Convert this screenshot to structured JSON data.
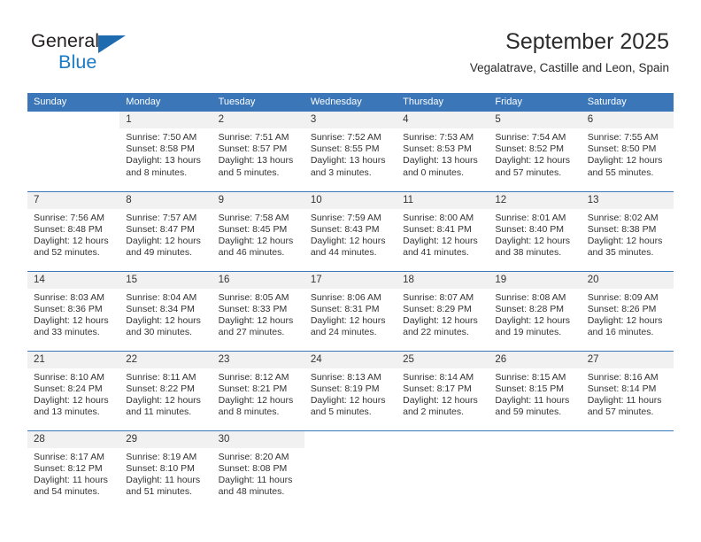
{
  "logo": {
    "word_top": "General",
    "word_bottom": "Blue",
    "triangle_color": "#1f6bb0",
    "blue_text_color": "#1a7ac4"
  },
  "header": {
    "title": "September 2025",
    "subtitle": "Vegalatrave, Castille and Leon, Spain"
  },
  "theme": {
    "header_row_bg": "#3a76b8",
    "header_row_text": "#ffffff",
    "daynum_bg": "#f1f1f1",
    "body_text": "#333333"
  },
  "weekdays": [
    "Sunday",
    "Monday",
    "Tuesday",
    "Wednesday",
    "Thursday",
    "Friday",
    "Saturday"
  ],
  "weeks": [
    [
      {
        "day": "",
        "blank": true,
        "empty": true,
        "sunrise": "",
        "sunset": "",
        "daylight_1": "",
        "daylight_2": ""
      },
      {
        "day": "1",
        "sunrise": "Sunrise: 7:50 AM",
        "sunset": "Sunset: 8:58 PM",
        "daylight_1": "Daylight: 13 hours",
        "daylight_2": "and 8 minutes."
      },
      {
        "day": "2",
        "sunrise": "Sunrise: 7:51 AM",
        "sunset": "Sunset: 8:57 PM",
        "daylight_1": "Daylight: 13 hours",
        "daylight_2": "and 5 minutes."
      },
      {
        "day": "3",
        "sunrise": "Sunrise: 7:52 AM",
        "sunset": "Sunset: 8:55 PM",
        "daylight_1": "Daylight: 13 hours",
        "daylight_2": "and 3 minutes."
      },
      {
        "day": "4",
        "sunrise": "Sunrise: 7:53 AM",
        "sunset": "Sunset: 8:53 PM",
        "daylight_1": "Daylight: 13 hours",
        "daylight_2": "and 0 minutes."
      },
      {
        "day": "5",
        "sunrise": "Sunrise: 7:54 AM",
        "sunset": "Sunset: 8:52 PM",
        "daylight_1": "Daylight: 12 hours",
        "daylight_2": "and 57 minutes."
      },
      {
        "day": "6",
        "sunrise": "Sunrise: 7:55 AM",
        "sunset": "Sunset: 8:50 PM",
        "daylight_1": "Daylight: 12 hours",
        "daylight_2": "and 55 minutes."
      }
    ],
    [
      {
        "day": "7",
        "sunrise": "Sunrise: 7:56 AM",
        "sunset": "Sunset: 8:48 PM",
        "daylight_1": "Daylight: 12 hours",
        "daylight_2": "and 52 minutes."
      },
      {
        "day": "8",
        "sunrise": "Sunrise: 7:57 AM",
        "sunset": "Sunset: 8:47 PM",
        "daylight_1": "Daylight: 12 hours",
        "daylight_2": "and 49 minutes."
      },
      {
        "day": "9",
        "sunrise": "Sunrise: 7:58 AM",
        "sunset": "Sunset: 8:45 PM",
        "daylight_1": "Daylight: 12 hours",
        "daylight_2": "and 46 minutes."
      },
      {
        "day": "10",
        "sunrise": "Sunrise: 7:59 AM",
        "sunset": "Sunset: 8:43 PM",
        "daylight_1": "Daylight: 12 hours",
        "daylight_2": "and 44 minutes."
      },
      {
        "day": "11",
        "sunrise": "Sunrise: 8:00 AM",
        "sunset": "Sunset: 8:41 PM",
        "daylight_1": "Daylight: 12 hours",
        "daylight_2": "and 41 minutes."
      },
      {
        "day": "12",
        "sunrise": "Sunrise: 8:01 AM",
        "sunset": "Sunset: 8:40 PM",
        "daylight_1": "Daylight: 12 hours",
        "daylight_2": "and 38 minutes."
      },
      {
        "day": "13",
        "sunrise": "Sunrise: 8:02 AM",
        "sunset": "Sunset: 8:38 PM",
        "daylight_1": "Daylight: 12 hours",
        "daylight_2": "and 35 minutes."
      }
    ],
    [
      {
        "day": "14",
        "sunrise": "Sunrise: 8:03 AM",
        "sunset": "Sunset: 8:36 PM",
        "daylight_1": "Daylight: 12 hours",
        "daylight_2": "and 33 minutes."
      },
      {
        "day": "15",
        "sunrise": "Sunrise: 8:04 AM",
        "sunset": "Sunset: 8:34 PM",
        "daylight_1": "Daylight: 12 hours",
        "daylight_2": "and 30 minutes."
      },
      {
        "day": "16",
        "sunrise": "Sunrise: 8:05 AM",
        "sunset": "Sunset: 8:33 PM",
        "daylight_1": "Daylight: 12 hours",
        "daylight_2": "and 27 minutes."
      },
      {
        "day": "17",
        "sunrise": "Sunrise: 8:06 AM",
        "sunset": "Sunset: 8:31 PM",
        "daylight_1": "Daylight: 12 hours",
        "daylight_2": "and 24 minutes."
      },
      {
        "day": "18",
        "sunrise": "Sunrise: 8:07 AM",
        "sunset": "Sunset: 8:29 PM",
        "daylight_1": "Daylight: 12 hours",
        "daylight_2": "and 22 minutes."
      },
      {
        "day": "19",
        "sunrise": "Sunrise: 8:08 AM",
        "sunset": "Sunset: 8:28 PM",
        "daylight_1": "Daylight: 12 hours",
        "daylight_2": "and 19 minutes."
      },
      {
        "day": "20",
        "sunrise": "Sunrise: 8:09 AM",
        "sunset": "Sunset: 8:26 PM",
        "daylight_1": "Daylight: 12 hours",
        "daylight_2": "and 16 minutes."
      }
    ],
    [
      {
        "day": "21",
        "sunrise": "Sunrise: 8:10 AM",
        "sunset": "Sunset: 8:24 PM",
        "daylight_1": "Daylight: 12 hours",
        "daylight_2": "and 13 minutes."
      },
      {
        "day": "22",
        "sunrise": "Sunrise: 8:11 AM",
        "sunset": "Sunset: 8:22 PM",
        "daylight_1": "Daylight: 12 hours",
        "daylight_2": "and 11 minutes."
      },
      {
        "day": "23",
        "sunrise": "Sunrise: 8:12 AM",
        "sunset": "Sunset: 8:21 PM",
        "daylight_1": "Daylight: 12 hours",
        "daylight_2": "and 8 minutes."
      },
      {
        "day": "24",
        "sunrise": "Sunrise: 8:13 AM",
        "sunset": "Sunset: 8:19 PM",
        "daylight_1": "Daylight: 12 hours",
        "daylight_2": "and 5 minutes."
      },
      {
        "day": "25",
        "sunrise": "Sunrise: 8:14 AM",
        "sunset": "Sunset: 8:17 PM",
        "daylight_1": "Daylight: 12 hours",
        "daylight_2": "and 2 minutes."
      },
      {
        "day": "26",
        "sunrise": "Sunrise: 8:15 AM",
        "sunset": "Sunset: 8:15 PM",
        "daylight_1": "Daylight: 11 hours",
        "daylight_2": "and 59 minutes."
      },
      {
        "day": "27",
        "sunrise": "Sunrise: 8:16 AM",
        "sunset": "Sunset: 8:14 PM",
        "daylight_1": "Daylight: 11 hours",
        "daylight_2": "and 57 minutes."
      }
    ],
    [
      {
        "day": "28",
        "sunrise": "Sunrise: 8:17 AM",
        "sunset": "Sunset: 8:12 PM",
        "daylight_1": "Daylight: 11 hours",
        "daylight_2": "and 54 minutes."
      },
      {
        "day": "29",
        "sunrise": "Sunrise: 8:19 AM",
        "sunset": "Sunset: 8:10 PM",
        "daylight_1": "Daylight: 11 hours",
        "daylight_2": "and 51 minutes."
      },
      {
        "day": "30",
        "sunrise": "Sunrise: 8:20 AM",
        "sunset": "Sunset: 8:08 PM",
        "daylight_1": "Daylight: 11 hours",
        "daylight_2": "and 48 minutes."
      },
      {
        "day": "",
        "blank": true,
        "sunrise": "",
        "sunset": "",
        "daylight_1": "",
        "daylight_2": ""
      },
      {
        "day": "",
        "blank": true,
        "sunrise": "",
        "sunset": "",
        "daylight_1": "",
        "daylight_2": ""
      },
      {
        "day": "",
        "blank": true,
        "sunrise": "",
        "sunset": "",
        "daylight_1": "",
        "daylight_2": ""
      },
      {
        "day": "",
        "blank": true,
        "sunrise": "",
        "sunset": "",
        "daylight_1": "",
        "daylight_2": ""
      }
    ]
  ]
}
